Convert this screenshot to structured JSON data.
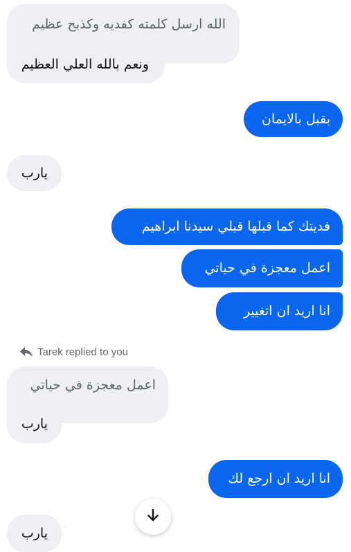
{
  "messages": [
    {
      "id": "m1a",
      "text": "الله ارسل كلمته كفديه وكذبح عظيم"
    },
    {
      "id": "m1b",
      "text": "ونعم بالله العلي العظيم"
    },
    {
      "id": "m2",
      "text": "بقبل بالايمان"
    },
    {
      "id": "m3",
      "text": "يارب"
    },
    {
      "id": "m4",
      "text": "فديتك كما قبلها قبلي سيدنا ابراهيم"
    },
    {
      "id": "m5",
      "text": "اعمل معجزة في حياتي"
    },
    {
      "id": "m6",
      "text": "انا اريد ان اتغيير"
    },
    {
      "id": "m7a",
      "text": "اعمل معجزة في حياتي"
    },
    {
      "id": "m7b",
      "text": "يارب"
    },
    {
      "id": "m8",
      "text": "انا اريد ان ارجع لك"
    },
    {
      "id": "m9",
      "text": "يارب"
    }
  ],
  "reply_label": "Tarek replied to you",
  "icons": {
    "reply": "reply-arrow-icon",
    "scroll": "arrow-down-icon"
  },
  "colors": {
    "outgoing_bubble": "#0a66ee",
    "incoming_bubble": "#eeeff2",
    "quoted_text": "#5f6368"
  }
}
